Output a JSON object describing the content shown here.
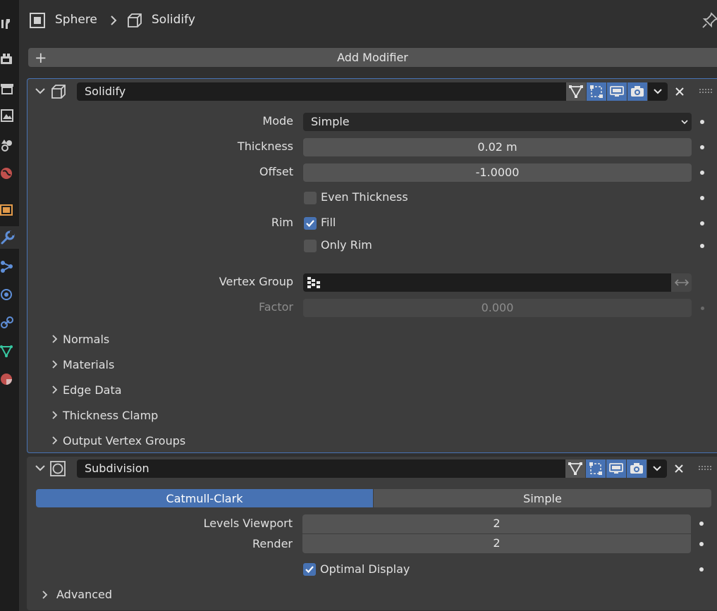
{
  "header": {
    "object_name": "Sphere",
    "modifier_name": "Solidify"
  },
  "add_modifier": {
    "label": "Add Modifier"
  },
  "solidify": {
    "name": "Solidify",
    "mode": {
      "label": "Mode",
      "value": "Simple"
    },
    "thickness": {
      "label": "Thickness",
      "value": "0.02 m"
    },
    "offset": {
      "label": "Offset",
      "value": "-1.0000"
    },
    "even_thickness": {
      "label": "Even Thickness",
      "checked": false
    },
    "rim": {
      "label": "Rim"
    },
    "fill": {
      "label": "Fill",
      "checked": true
    },
    "only_rim": {
      "label": "Only Rim",
      "checked": false
    },
    "vertex_group": {
      "label": "Vertex Group",
      "value": ""
    },
    "factor": {
      "label": "Factor",
      "value": "0.000"
    },
    "subpanels": [
      "Normals",
      "Materials",
      "Edge Data",
      "Thickness Clamp",
      "Output Vertex Groups"
    ]
  },
  "subdivision": {
    "name": "Subdivision",
    "type_options": [
      "Catmull-Clark",
      "Simple"
    ],
    "selected_type": "Catmull-Clark",
    "levels_viewport": {
      "label": "Levels Viewport",
      "value": "2"
    },
    "render": {
      "label": "Render",
      "value": "2"
    },
    "optimal_display": {
      "label": "Optimal Display",
      "checked": true
    },
    "advanced": {
      "label": "Advanced"
    }
  },
  "colors": {
    "accent": "#4772b3",
    "panel_bg": "#3d3d3d",
    "editor_bg": "#303030",
    "field_bg": "#545454",
    "tab_strip_bg": "#1d1d1d"
  },
  "icons": {
    "tabs": [
      "tool-icon",
      "render-icon",
      "output-icon",
      "view-layer-icon",
      "scene-icon",
      "world-icon",
      "object-icon",
      "modifier-icon",
      "particles-icon",
      "physics-icon",
      "constraints-icon",
      "data-icon",
      "material-icon"
    ]
  }
}
